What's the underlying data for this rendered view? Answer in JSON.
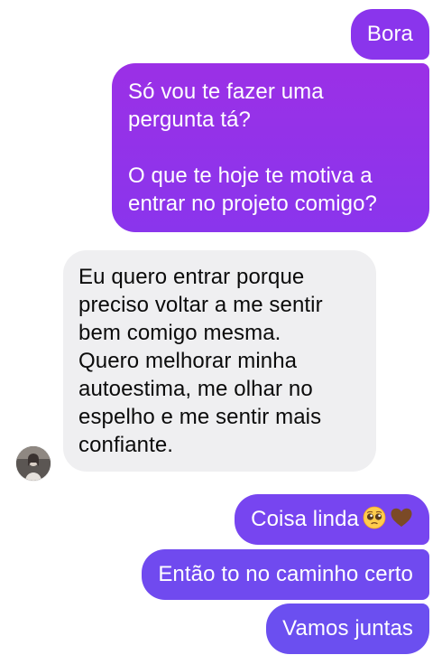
{
  "messages": [
    {
      "id": 1,
      "text": "Bora"
    },
    {
      "id": 2,
      "text": "Só vou te fazer uma\npergunta tá?\n\nO que te hoje te motiva a\nentrar no projeto comigo?"
    },
    {
      "id": 3,
      "text": "Eu quero entrar porque\npreciso voltar a me sentir\nbem comigo mesma.\nQuero melhorar minha\nautoestima, me olhar no\nespelho e me sentir mais\nconfiante."
    },
    {
      "id": 4,
      "text": "Coisa linda",
      "emojis": [
        "pleading-face-icon",
        "brown-heart-icon"
      ]
    },
    {
      "id": 5,
      "text": "Então to no caminho certo"
    },
    {
      "id": 6,
      "text": "Vamos juntas"
    }
  ],
  "colors": {
    "outgoing_top": "#9b30e6",
    "outgoing_bottom": "#6b4ff0",
    "incoming_bg": "#efeff1",
    "incoming_text": "#0b0b0b"
  }
}
